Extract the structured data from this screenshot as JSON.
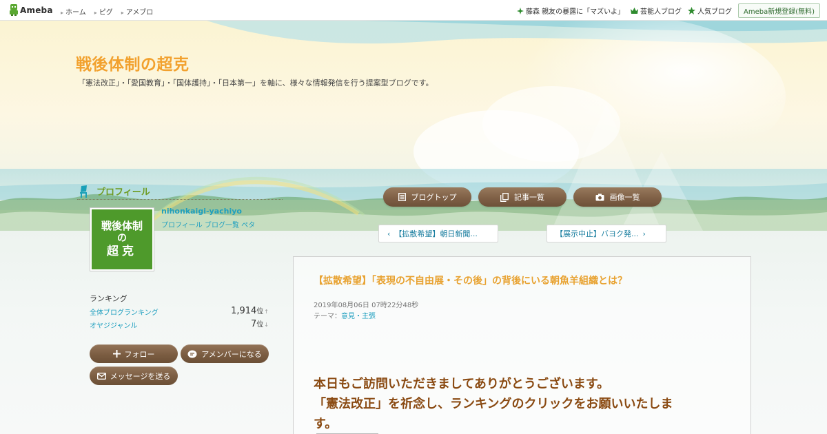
{
  "topbar": {
    "logo_text": "Ameba",
    "nav": [
      {
        "label": "ホーム"
      },
      {
        "label": "ピグ"
      },
      {
        "label": "アメブロ"
      }
    ],
    "right": [
      {
        "label": "藤森 親友の暴露に「マズいよ」",
        "icon": "sparkle-icon"
      },
      {
        "label": "芸能人ブログ",
        "icon": "crown-icon"
      },
      {
        "label": "人気ブログ",
        "icon": "star-icon"
      }
    ],
    "signup_label": "Ameba新規登録(無料)"
  },
  "blog": {
    "title": "戦後体制の超克",
    "description": "「憲法改正」・「愛国教育」・「国体護持」・「日本第一」を軸に、様々な情報発信を行う提案型ブログです。"
  },
  "profile": {
    "heading": "プロフィール",
    "avatar_line1": "戦後体制",
    "avatar_line2": "の",
    "avatar_line3": "超克",
    "name": "nihonkaigi-yachiyo",
    "links": "プロフィール ブログ一覧 ペタ",
    "ranking_title": "ランキング",
    "ranking": [
      {
        "name": "全体ブログランキング",
        "value": "1,914",
        "unit": "位",
        "arrow": "↑"
      },
      {
        "name": "オヤジジャンル",
        "value": "7",
        "unit": "位",
        "arrow": "↓"
      }
    ],
    "follow_label": "フォロー",
    "amember_label": "アメンバーになる",
    "message_label": "メッセージを送る"
  },
  "nav_buttons": {
    "blog_top": "ブログトップ",
    "article_list": "記事一覧",
    "image_list": "画像一覧"
  },
  "pager": {
    "prev": "【拡散希望】朝日新聞...",
    "next": "【展示中止】バヨク発..."
  },
  "article": {
    "title": "【拡散希望】「表現の不自由展・その後」の背後にいる朝魚羊組織とは？",
    "date": "2019年08月06日 07時22分48秒",
    "theme_label": "テーマ：",
    "theme_value": "意見・主張",
    "body_line1": "本日もご訪問いただきましてありがとうございます。",
    "body_line2": "「憲法改正」を祈念し、ランキングのクリックをお願いいたしま",
    "body_line3": "す。"
  },
  "colors": {
    "title_orange": "#f2a12e",
    "link_blue": "#1f9fbf",
    "button_brown": "#7b5d42",
    "avatar_green": "#4e9a2b",
    "body_brown": "#8a4a12"
  }
}
